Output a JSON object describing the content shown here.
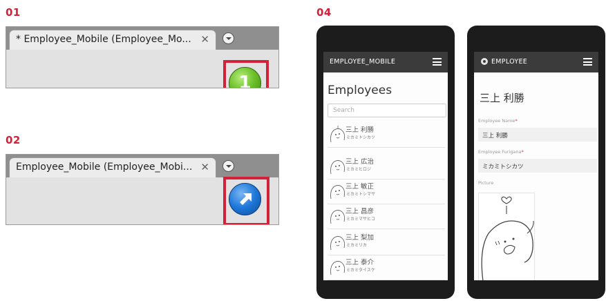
{
  "steps": [
    {
      "label": "01",
      "tab_title": "* Employee_Mobile (Employee_Mo...",
      "close": "✕",
      "badge": "1"
    },
    {
      "label": "02",
      "tab_title": "Employee_Mobile (Employee_Mobi...",
      "close": "✕"
    }
  ],
  "step04": {
    "label": "04",
    "list_screen": {
      "appbar_title": "EMPLOYEE_MOBILE",
      "heading": "Employees",
      "search_placeholder": "Search",
      "employees": [
        {
          "name": "三上 利勝",
          "kana": "ミカミトシカツ"
        },
        {
          "name": "三上 広治",
          "kana": "ミカミヒロジ"
        },
        {
          "name": "三上 敏正",
          "kana": "ミカミトシマサ"
        },
        {
          "name": "三上 昌彦",
          "kana": "ミカミマサヒコ"
        },
        {
          "name": "三上 梨加",
          "kana": "ミカミリカ"
        },
        {
          "name": "三上 泰介",
          "kana": "ミカミタイスケ"
        }
      ]
    },
    "detail_screen": {
      "appbar_title": "EMPLOYEE",
      "heading": "三上 利勝",
      "name_label": "Employee Name",
      "name_value": "三上 利勝",
      "furigana_label": "Employee Furigana",
      "furigana_value": "ミカミトシカツ",
      "required_mark": "*",
      "picture_label": "Picture"
    }
  },
  "colors": {
    "accent": "#d4213a",
    "badge_green": "#6ec12b",
    "badge_blue": "#1e77d8",
    "appbar": "#3b3b3b"
  },
  "icons": [
    "close-icon",
    "chevron-down-icon",
    "notification-badge",
    "open-external-icon",
    "menu-icon",
    "app-logo-icon",
    "avatar-icon"
  ]
}
